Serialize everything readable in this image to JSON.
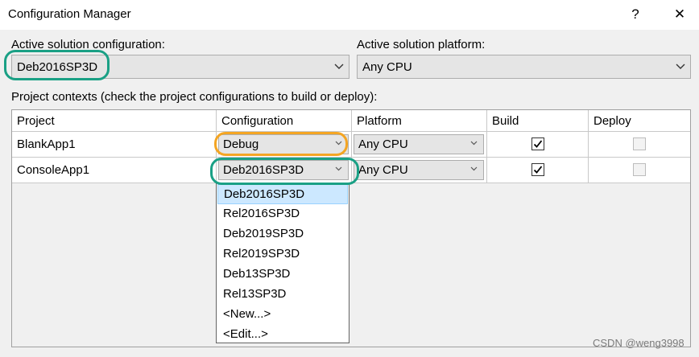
{
  "window": {
    "title": "Configuration Manager",
    "help": "?",
    "close": "✕"
  },
  "solution": {
    "config_label": "Active solution configuration:",
    "config_value": "Deb2016SP3D",
    "platform_label": "Active solution platform:",
    "platform_value": "Any CPU",
    "dropdown_icon": "chevron-down-icon"
  },
  "contexts_label": "Project contexts (check the project configurations to build or deploy):",
  "table": {
    "headers": [
      "Project",
      "Configuration",
      "Platform",
      "Build",
      "Deploy"
    ],
    "rows": [
      {
        "project": "BlankApp1",
        "configuration": "Debug",
        "platform": "Any CPU",
        "build": true,
        "deploy": false
      },
      {
        "project": "ConsoleApp1",
        "configuration": "Deb2016SP3D",
        "platform": "Any CPU",
        "build": true,
        "deploy": false
      }
    ]
  },
  "dropdown": {
    "options": [
      "Deb2016SP3D",
      "Rel2016SP3D",
      "Deb2019SP3D",
      "Rel2019SP3D",
      "Deb13SP3D",
      "Rel13SP3D",
      "<New...>",
      "<Edit...>"
    ],
    "selected": "Deb2016SP3D"
  },
  "annotation_colors": {
    "green": "#1aa085",
    "orange": "#f4a523"
  },
  "watermark": "CSDN @weng3998"
}
